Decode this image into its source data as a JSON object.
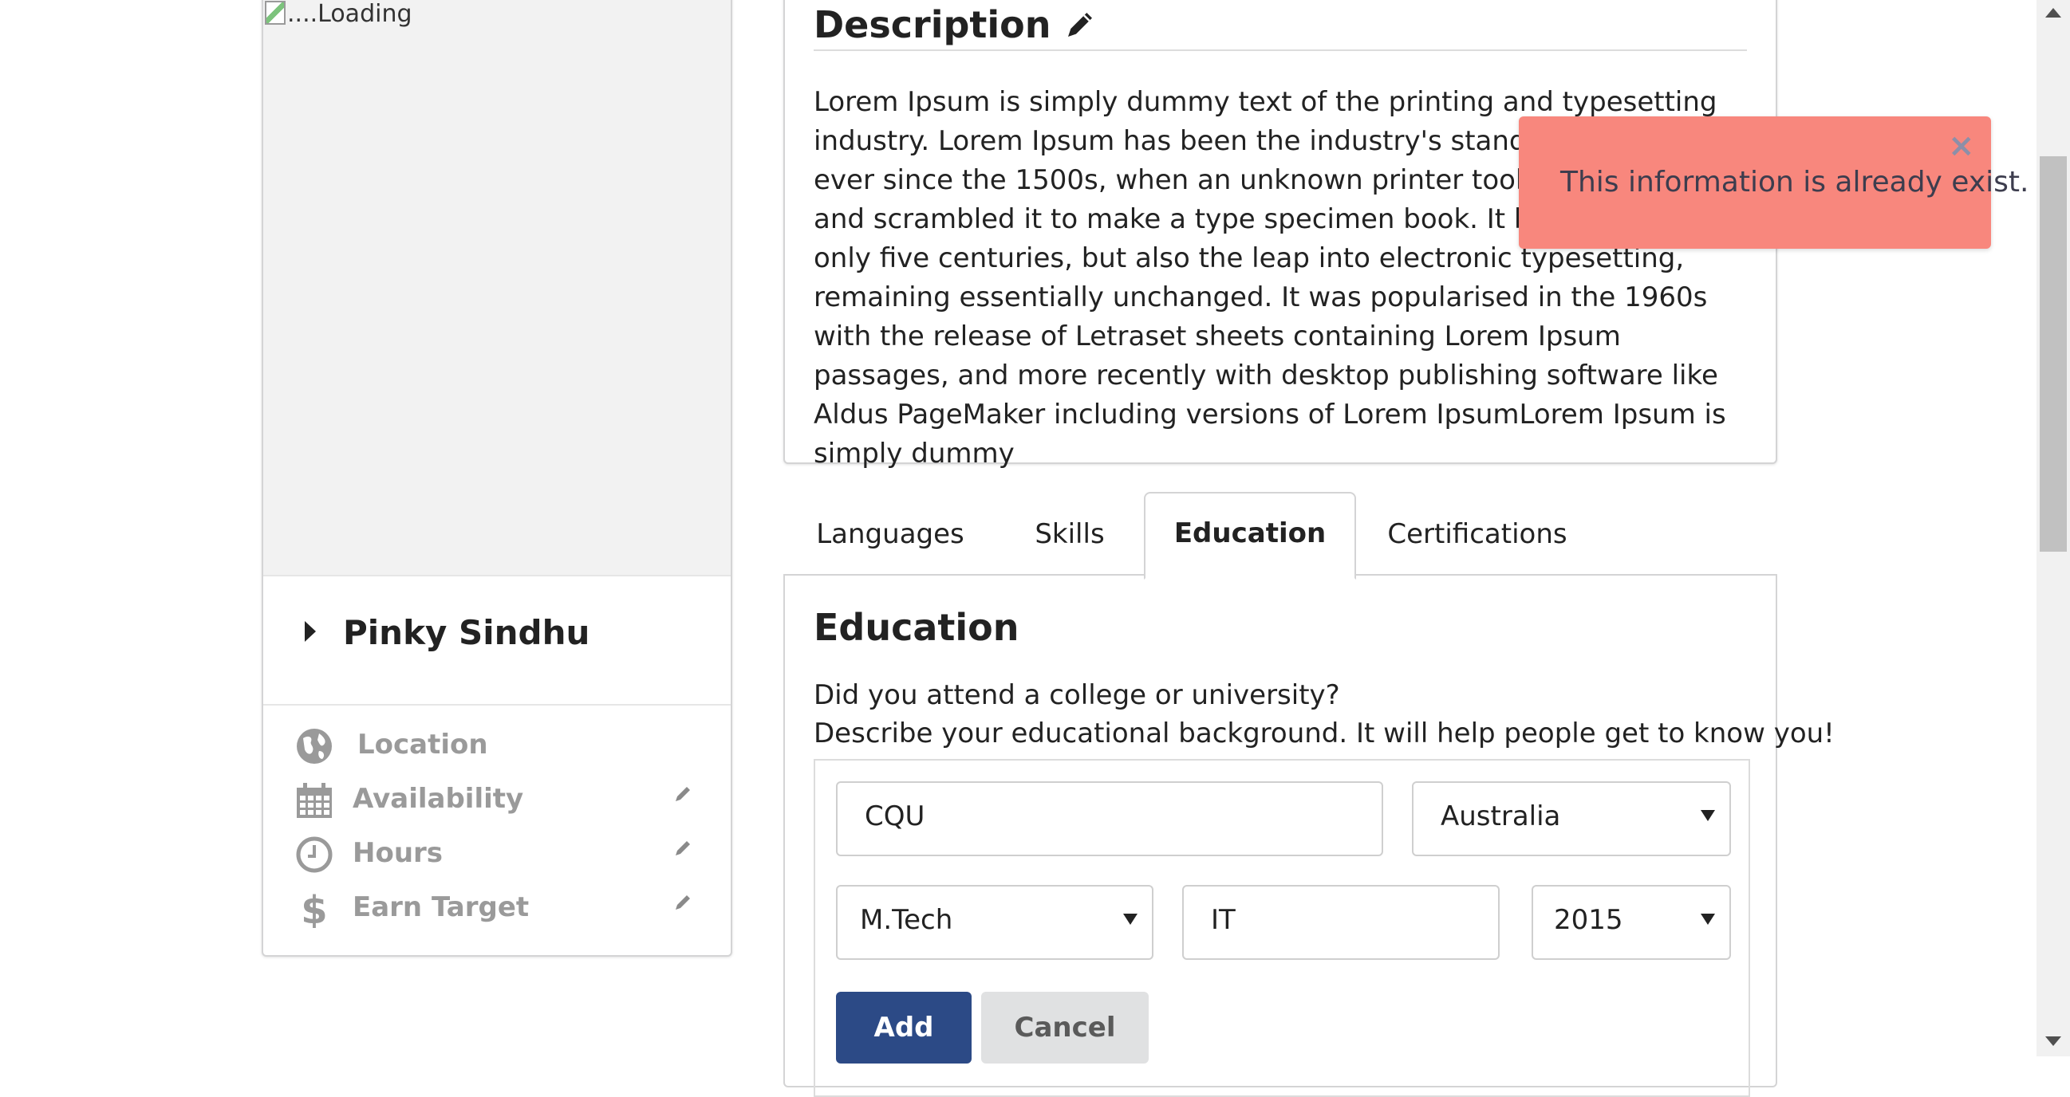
{
  "profile": {
    "image_alt": "....Loading",
    "name": "Pinky Sindhu",
    "items": [
      {
        "label": "Location",
        "icon": "globe-icon",
        "editable": false
      },
      {
        "label": "Availability",
        "icon": "calendar-icon",
        "editable": true
      },
      {
        "label": "Hours",
        "icon": "clock-icon",
        "editable": true
      },
      {
        "label": "Earn Target",
        "icon": "dollar-icon",
        "editable": true
      }
    ]
  },
  "description": {
    "title": "Description",
    "text": "Lorem Ipsum is simply dummy text of the printing and typesetting industry. Lorem Ipsum has been the industry's standard dummy text ever since the 1500s, when an unknown printer took a galley of type and scrambled it to make a type specimen book. It has survived not only five centuries, but also the leap into electronic typesetting, remaining essentially unchanged. It was popularised in the 1960s with the release of Letraset sheets containing Lorem Ipsum passages, and more recently with desktop publishing software like Aldus PageMaker including versions of Lorem IpsumLorem Ipsum is simply dummy"
  },
  "tabs": [
    {
      "label": "Languages",
      "active": false
    },
    {
      "label": "Skills",
      "active": false
    },
    {
      "label": "Education",
      "active": true
    },
    {
      "label": "Certifications",
      "active": false
    }
  ],
  "education": {
    "title": "Education",
    "line1": "Did you attend a college or university?",
    "line2": "Describe your educational background. It will help people get to know you!",
    "university": "CQU",
    "country": "Australia",
    "degree": "M.Tech",
    "subject": "IT",
    "year": "2015",
    "add_label": "Add",
    "cancel_label": "Cancel"
  },
  "toast": {
    "message": "This information is already exist.",
    "close": "×"
  },
  "colors": {
    "primary": "#2c4a86",
    "toast": "#f8877d"
  }
}
